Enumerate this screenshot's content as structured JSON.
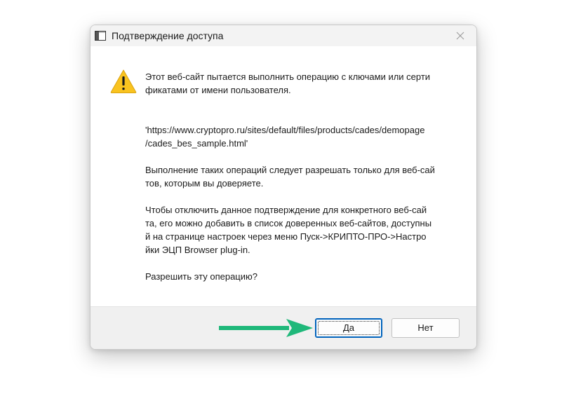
{
  "dialog": {
    "title": "Подтверждение доступа",
    "icons": {
      "app": "window-icon",
      "close": "close-icon",
      "warning": "warning-triangle-icon",
      "annotation": "arrow-right-icon"
    },
    "colors": {
      "warning_fill": "#f9c31f",
      "accent": "#0067c0",
      "arrow": "#1fb87a"
    },
    "message": {
      "paragraph1": [
        "Этот веб-сайт пытается выполнить операцию с ключами или серти",
        "фикатами от имени пользователя."
      ],
      "url": [
        "'https://www.cryptopro.ru/sites/default/files/products/cades/demopage",
        "/cades_bes_sample.html'"
      ],
      "paragraph2": [
        "Выполнение таких операций следует разрешать только для веб-сай",
        "тов, которым вы доверяете."
      ],
      "paragraph3": [
        "Чтобы отключить данное подтверждение для конкретного веб-сай",
        "та, его можно добавить в список доверенных веб-сайтов, доступны",
        "й на странице настроек через меню Пуск->КРИПТО-ПРО->Настро",
        "йки ЭЦП Browser plug-in."
      ],
      "question": "Разрешить эту операцию?"
    },
    "buttons": {
      "yes_label": "Да",
      "no_label": "Нет"
    }
  }
}
